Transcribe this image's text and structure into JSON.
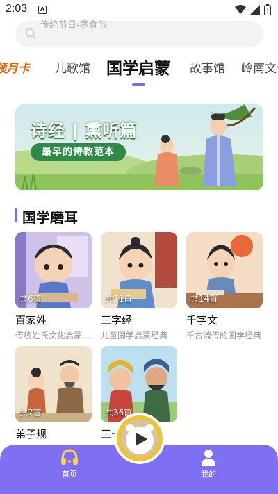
{
  "status_bar": {
    "time": "2:03",
    "notification_icon": "A"
  },
  "search": {
    "placeholder": "传统节日-寒食节"
  },
  "tabs": [
    {
      "label": "领月卡"
    },
    {
      "label": "儿歌馆"
    },
    {
      "label": "国学启蒙"
    },
    {
      "label": "故事馆"
    },
    {
      "label": "岭南文化"
    }
  ],
  "banner": {
    "title": "诗经 | 熏听篇",
    "subtitle": "最早的诗教范本"
  },
  "section": {
    "title": "国学磨耳"
  },
  "cards": [
    {
      "count": "共6首",
      "title": "百家姓",
      "desc": "传统姓氏文化启蒙经典"
    },
    {
      "count": "共11首",
      "title": "三字经",
      "desc": "儿童国学启蒙经典"
    },
    {
      "count": "共14首",
      "title": "千字文",
      "desc": "千古流传的国学经典"
    },
    {
      "count": "共7首",
      "title": "弟子规",
      "desc": ""
    },
    {
      "count": "共36首",
      "title": "三十",
      "desc": ""
    }
  ],
  "bottom_nav": {
    "home_label": "首页",
    "mine_label": "我的"
  },
  "colors": {
    "accent": "#7a6cf0",
    "nav_bg": "#7f6ff2",
    "month_card": "#e8610a",
    "play_ring": "#f1c232"
  }
}
